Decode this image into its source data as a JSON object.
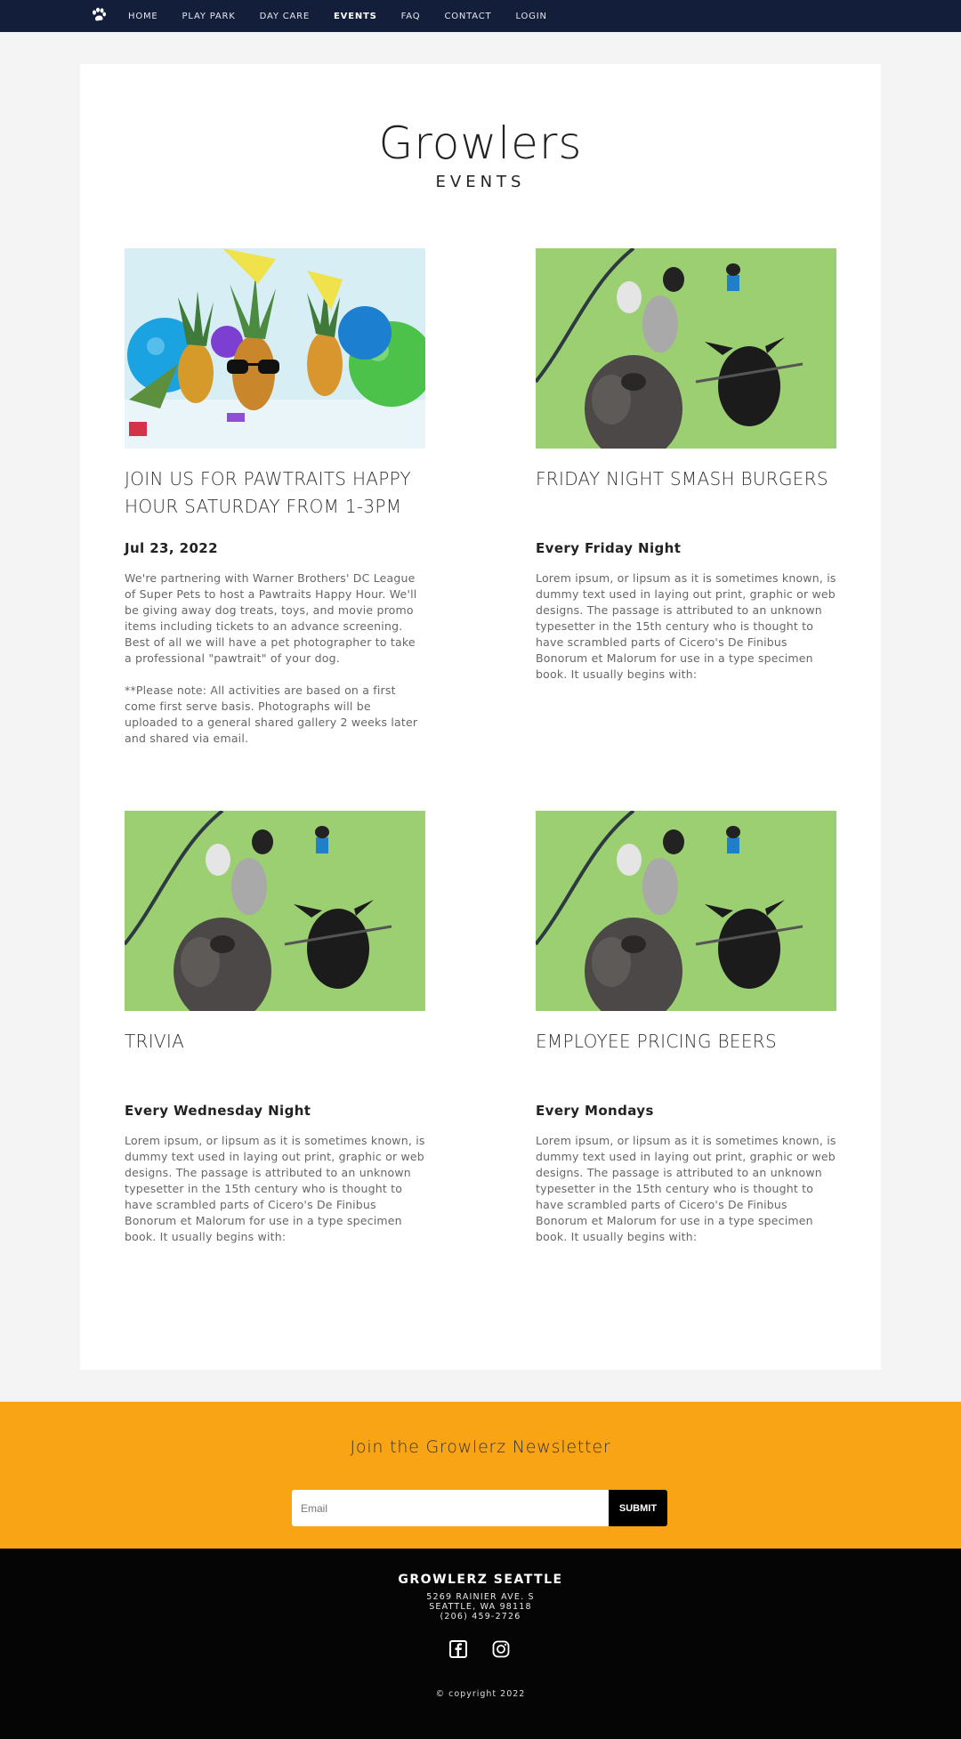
{
  "nav": {
    "logo_icon": "paw-icon",
    "links": [
      {
        "label": "HOME",
        "active": false
      },
      {
        "label": "PLAY PARK",
        "active": false
      },
      {
        "label": "DAY CARE",
        "active": false
      },
      {
        "label": "EVENTS",
        "active": true
      },
      {
        "label": "FAQ",
        "active": false
      },
      {
        "label": "CONTACT",
        "active": false
      },
      {
        "label": "LOGIN",
        "active": false
      }
    ]
  },
  "header": {
    "brand": "Growlers",
    "subtitle": "EVENTS"
  },
  "events": [
    {
      "image": "party-pineapples-photo",
      "title": "JOIN US FOR PAWTRAITS HAPPY HOUR SATURDAY FROM 1-3PM",
      "date": "Jul 23, 2022",
      "description": "We're partnering with Warner Brothers' DC League of Super Pets to host a Pawtraits Happy Hour. We'll be giving away dog treats, toys, and movie promo items including tickets to an advance screening. Best of all we will have a pet photographer to take a professional \"pawtrait\" of your dog.\n\n**Please note: All activities are based on a first come first serve basis. Photographs will be uploaded to a general shared gallery 2 weeks later and shared via email."
    },
    {
      "image": "dogs-on-turf-photo",
      "title": "FRIDAY NIGHT SMASH BURGERS",
      "date": "Every Friday Night",
      "description": "Lorem ipsum, or lipsum as it is sometimes known, is dummy text used in laying out print, graphic or web designs. The passage is attributed to an unknown typesetter in the 15th century who is thought to have scrambled parts of Cicero's De Finibus Bonorum et Malorum for use in a type specimen book. It usually begins with:"
    },
    {
      "image": "dogs-on-turf-photo",
      "title": "TRIVIA",
      "date": "Every Wednesday Night",
      "description": "Lorem ipsum, or lipsum as it is sometimes known, is dummy text used in laying out print, graphic or web designs. The passage is attributed to an unknown typesetter in the 15th century who is thought to have scrambled parts of Cicero's De Finibus Bonorum et Malorum for use in a type specimen book. It usually begins with:"
    },
    {
      "image": "dogs-on-turf-photo",
      "title": "EMPLOYEE PRICING BEERS",
      "date": "Every Mondays",
      "description": "Lorem ipsum, or lipsum as it is sometimes known, is dummy text used in laying out print, graphic or web designs. The passage is attributed to an unknown typesetter in the 15th century who is thought to have scrambled parts of Cicero's De Finibus Bonorum et Malorum for use in a type specimen book. It usually begins with:"
    }
  ],
  "newsletter": {
    "title": "Join the Growlerz Newsletter",
    "email_placeholder": "Email",
    "submit_label": "SUBMIT",
    "accent_color": "#f9a414"
  },
  "footer": {
    "name": "GROWLERZ SEATTLE",
    "address_line1": "5269 RAINIER AVE. S",
    "address_line2": "SEATTLE, WA 98118",
    "phone": "(206) 459-2726",
    "social_icons": [
      "facebook-icon",
      "instagram-icon"
    ],
    "copyright": "© copyright 2022"
  },
  "colors": {
    "nav_bg": "#131e3b",
    "footer_bg": "#050505",
    "page_bg": "#f4f4f4"
  }
}
